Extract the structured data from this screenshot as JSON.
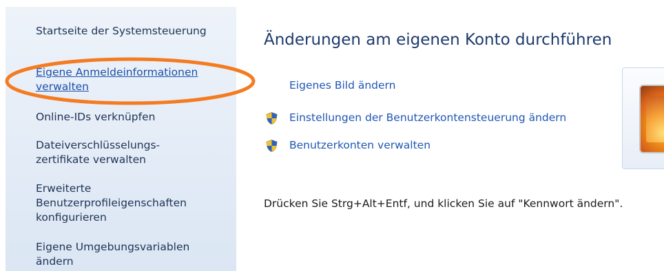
{
  "sidebar": {
    "home_link": "Startseite der Systemsteuerung",
    "items": [
      {
        "line1": "Eigene Anmeldeinformationen",
        "line2": "verwalten"
      },
      {
        "line1": "Online-IDs verknüpfen"
      },
      {
        "line1": "Dateiverschlüsselungs-",
        "line2": "zertifikate verwalten"
      },
      {
        "line1": "Erweiterte",
        "line2": "Benutzerprofileigenschaften",
        "line3": "konfigurieren"
      },
      {
        "line1": "Eigene Umgebungsvariablen",
        "line2": "ändern"
      }
    ]
  },
  "main": {
    "title": "Änderungen am eigenen Konto durchführen",
    "links": [
      {
        "label": "Eigenes Bild ändern"
      },
      {
        "label": "Einstellungen der Benutzerkontensteuerung ändern",
        "icon": "uac-shield-icon"
      },
      {
        "label": "Benutzerkonten verwalten",
        "icon": "uac-shield-icon"
      }
    ],
    "info": "Drücken Sie Strg+Alt+Entf, und klicken Sie auf \"Kennwort ändern\"."
  },
  "colors": {
    "highlight_ellipse": "#f47b20",
    "link": "#1f56b4",
    "sidebar_bg": "#dbe6f4"
  }
}
